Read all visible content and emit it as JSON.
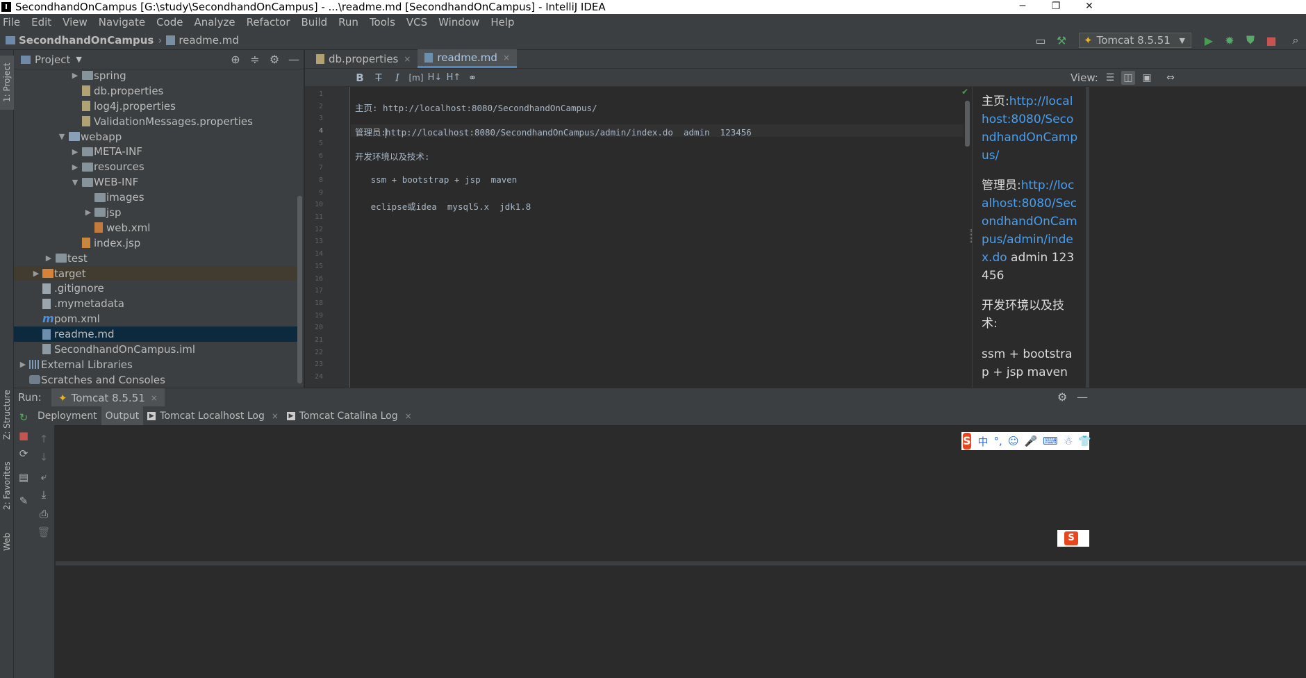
{
  "window": {
    "title": "SecondhandOnCampus [G:\\study\\SecondhandOnCampus] - ...\\readme.md [SecondhandOnCampus] - IntelliJ IDEA",
    "minimize": "─",
    "restore": "❐",
    "close": "✕"
  },
  "menu": [
    "File",
    "Edit",
    "View",
    "Navigate",
    "Code",
    "Analyze",
    "Refactor",
    "Build",
    "Run",
    "Tools",
    "VCS",
    "Window",
    "Help"
  ],
  "breadcrumb": {
    "project": "SecondhandOnCampus",
    "file": "readme.md",
    "separator": "›"
  },
  "toolbar": {
    "run_config": "Tomcat 8.5.51"
  },
  "side_tabs": {
    "project": "1: Project",
    "structure": "Z: Structure",
    "favorites": "2: Favorites",
    "web": "Web"
  },
  "project_panel": {
    "title": "Project",
    "items": [
      {
        "label": "spring",
        "type": "folder",
        "expand": "▶"
      },
      {
        "label": "db.properties",
        "type": "prop"
      },
      {
        "label": "log4j.properties",
        "type": "prop"
      },
      {
        "label": "ValidationMessages.properties",
        "type": "prop"
      },
      {
        "label": "webapp",
        "type": "folder-web",
        "expand": "▼"
      },
      {
        "label": "META-INF",
        "type": "folder",
        "expand": "▶"
      },
      {
        "label": "resources",
        "type": "folder",
        "expand": "▶"
      },
      {
        "label": "WEB-INF",
        "type": "folder",
        "expand": "▼"
      },
      {
        "label": "images",
        "type": "folder"
      },
      {
        "label": "jsp",
        "type": "folder",
        "expand": "▶"
      },
      {
        "label": "web.xml",
        "type": "xml"
      },
      {
        "label": "index.jsp",
        "type": "jsp"
      },
      {
        "label": "test",
        "type": "folder",
        "expand": "▶"
      },
      {
        "label": "target",
        "type": "folder-orange",
        "expand": "▶"
      },
      {
        "label": ".gitignore",
        "type": "file"
      },
      {
        "label": ".mymetadata",
        "type": "file"
      },
      {
        "label": "pom.xml",
        "type": "maven",
        "icon_text": "m"
      },
      {
        "label": "readme.md",
        "type": "md"
      },
      {
        "label": "SecondhandOnCampus.iml",
        "type": "iml"
      },
      {
        "label": "External Libraries",
        "type": "lib",
        "expand": "▶"
      },
      {
        "label": "Scratches and Consoles",
        "type": "scratch"
      }
    ]
  },
  "editor_tabs": [
    {
      "label": "db.properties",
      "close": "×"
    },
    {
      "label": "readme.md",
      "close": "×"
    }
  ],
  "md_toolbar": {
    "view_label": "View:"
  },
  "editor": {
    "line_numbers": [
      "1",
      "2",
      "3",
      "4",
      "5",
      "6",
      "7",
      "8",
      "9",
      "10",
      "11",
      "12",
      "13",
      "14",
      "15",
      "16",
      "17",
      "18",
      "19",
      "20",
      "21",
      "22",
      "23",
      "24"
    ],
    "lines": {
      "l2": "主页: http://localhost:8080/SecondhandOnCampus/",
      "l4_prefix": "管理员:",
      "l4_cursor_char": "h",
      "l4_rest": "ttp://localhost:8080/SecondhandOnCampus/admin/index.do  admin  123456",
      "l6": "开发环境以及技术:",
      "l8": "   ssm + bootstrap + jsp  maven",
      "l10": "   eclipse或idea  mysql5.x  jdk1.8"
    }
  },
  "preview": {
    "p1_label": "主页:",
    "p1_link": "http://localhost:8080/SecondhandOnCampus/",
    "p2_label": "管理员:",
    "p2_link": "http://localhost:8080/SecondhandOnCampus/admin/index.do",
    "p2_tail": " admin 123456",
    "p3": "开发环境以及技术:",
    "p4": "ssm + bootstrap + jsp maven"
  },
  "run_panel": {
    "label": "Run:",
    "tab": "Tomcat 8.5.51",
    "subtabs": [
      {
        "label": "Deployment"
      },
      {
        "label": "Output"
      },
      {
        "label": "Tomcat Localhost Log",
        "close": "×"
      },
      {
        "label": "Tomcat Catalina Log",
        "close": "×"
      }
    ]
  },
  "ime": {
    "logo": "S",
    "mode": "中"
  }
}
